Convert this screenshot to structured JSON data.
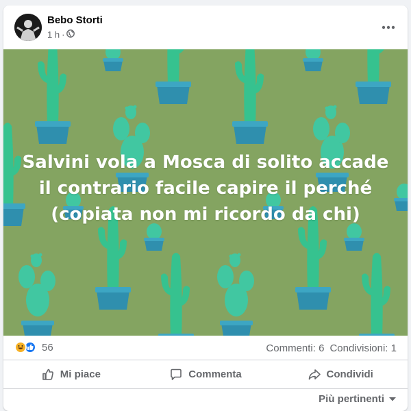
{
  "post": {
    "author": "Bebo Storti",
    "time": "1 h",
    "separator": "·",
    "audience_icon": "globe-icon",
    "more_icon": "more-horizontal-icon",
    "text_lines": [
      "Salvini vola a Mosca di solito accade",
      "il contrario facile capire il perché",
      "(copiata non mi ricordo da chi)"
    ],
    "background_color": "#84a461"
  },
  "stats": {
    "reaction_icons": [
      "haha-icon",
      "like-icon"
    ],
    "reaction_count": "56",
    "comments": "Commenti: 6",
    "shares": "Condivisioni: 1"
  },
  "actions": {
    "like": "Mi piace",
    "comment": "Commenta",
    "share": "Condividi"
  },
  "sort": {
    "label": "Più pertinenti"
  },
  "colors": {
    "accent": "#1877f2",
    "haha": "#f7b125",
    "secondary_text": "#65676b",
    "cactus": "#2fbf9a",
    "pot": "#2f89a6"
  }
}
